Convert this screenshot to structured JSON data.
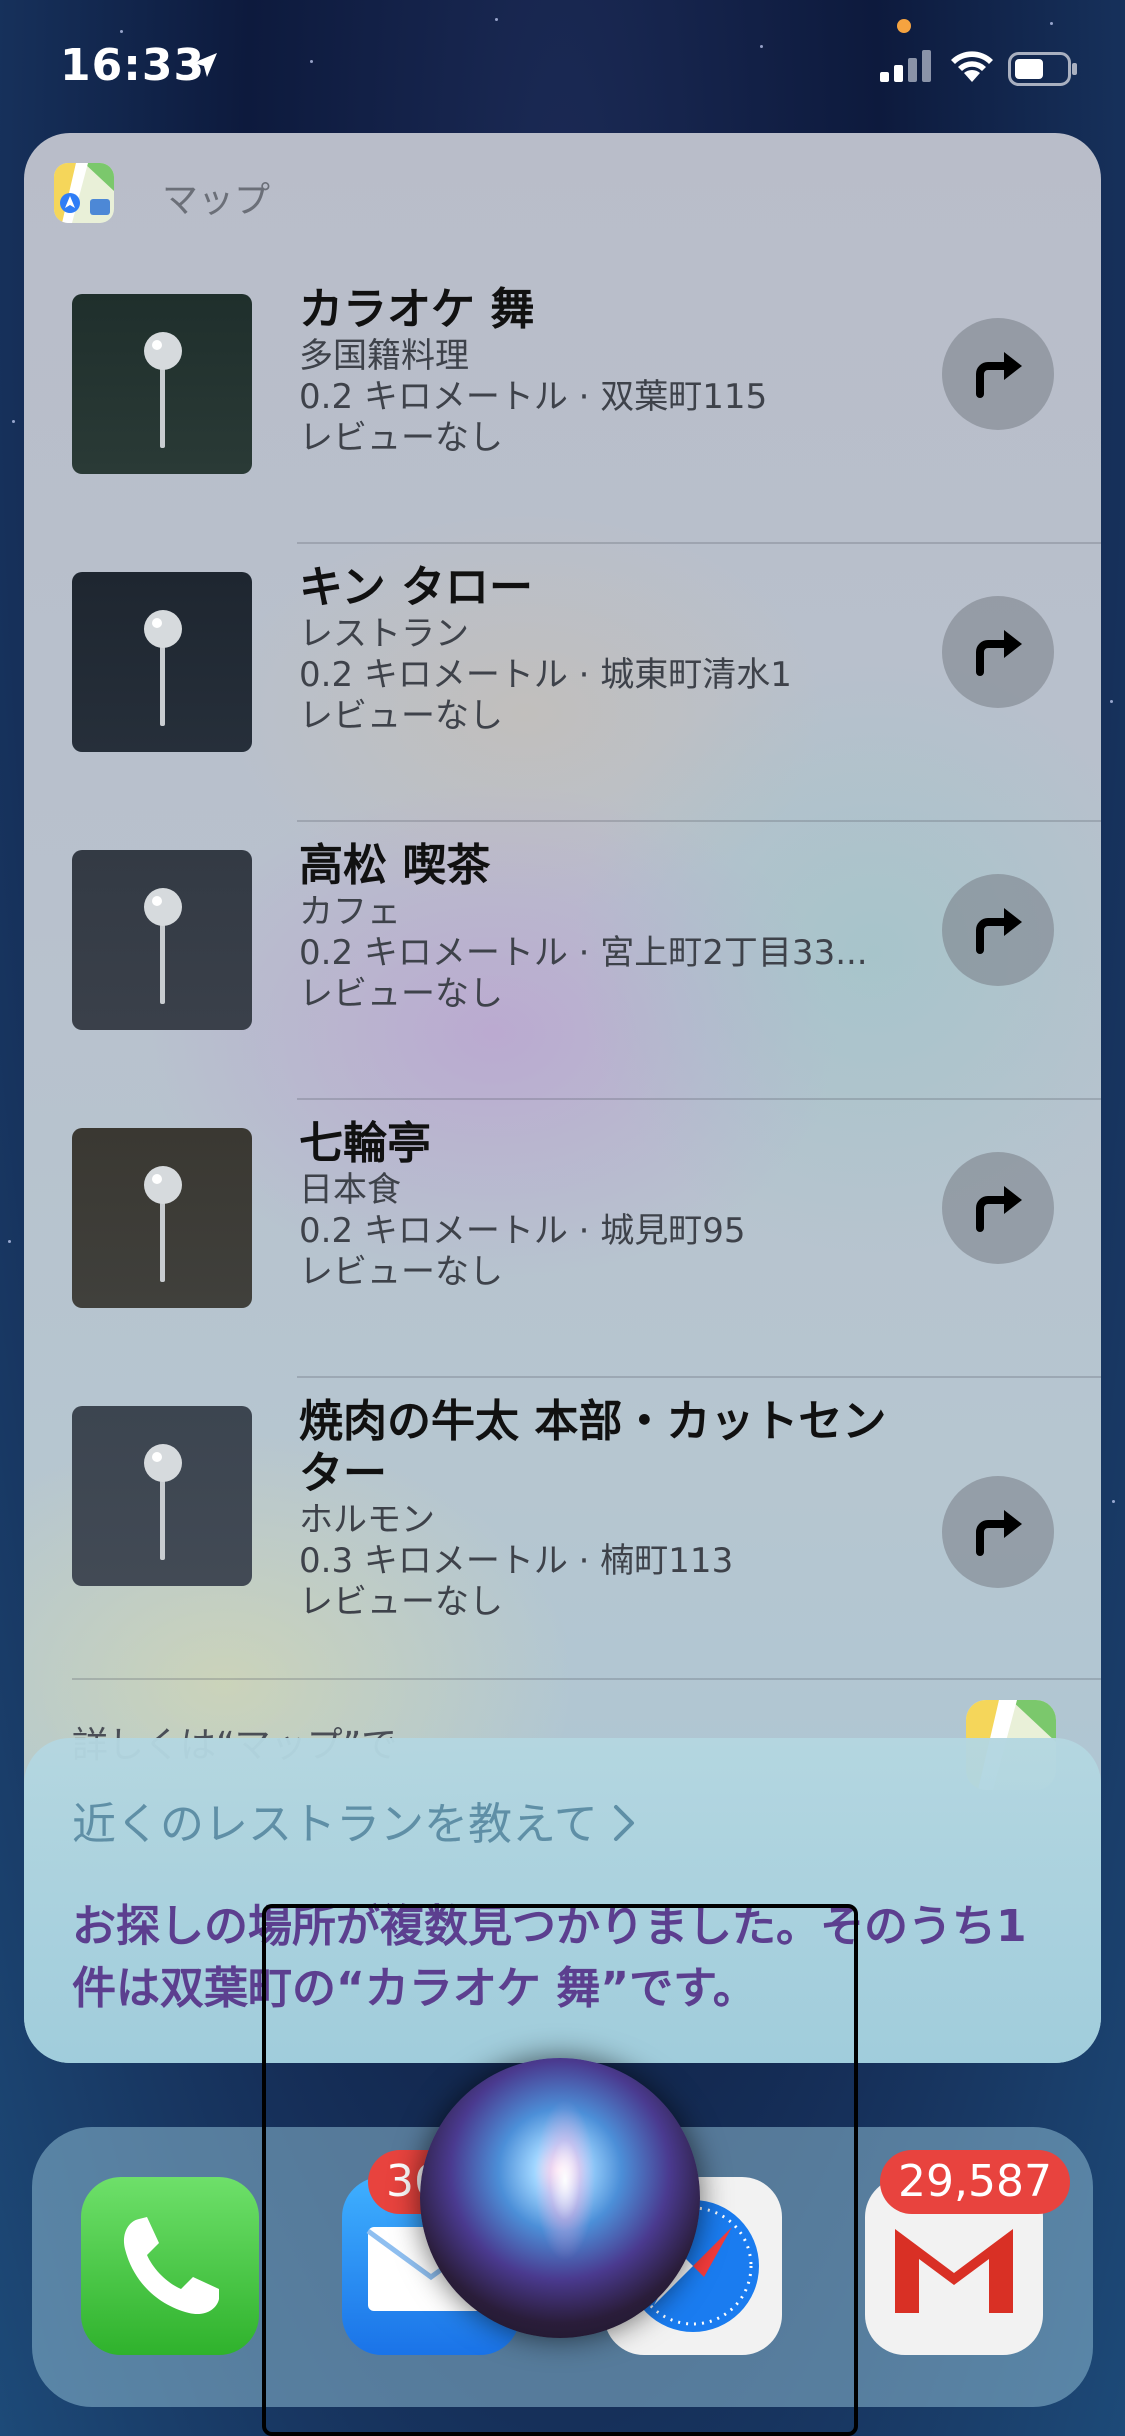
{
  "status_bar": {
    "time": "16:33",
    "location_icon": "location-arrow-icon",
    "signal_icon": "cellular-signal-icon",
    "wifi_icon": "wifi-icon",
    "battery_icon": "battery-icon"
  },
  "maps_card": {
    "app_name": "マップ",
    "app_icon": "maps-app-icon",
    "results": [
      {
        "name": "カラオケ 舞",
        "category": "多国籍料理",
        "distance_address": "0.2 キロメートル · 双葉町115",
        "review": "レビューなし"
      },
      {
        "name": "キン タロー",
        "category": "レストラン",
        "distance_address": "0.2 キロメートル · 城東町清水1",
        "review": "レビューなし"
      },
      {
        "name": "高松 喫茶",
        "category": "カフェ",
        "distance_address": "0.2 キロメートル · 宮上町2丁目33...",
        "review": "レビューなし"
      },
      {
        "name": "七輪亭",
        "category": "日本食",
        "distance_address": "0.2 キロメートル · 城見町95",
        "review": "レビューなし"
      },
      {
        "name": "焼肉の牛太 本部・カットセンター",
        "category": "ホルモン",
        "distance_address": "0.3 キロメートル · 楠町113",
        "review": "レビューなし"
      }
    ],
    "more_text": "詳しくは“マップ”で"
  },
  "siri": {
    "query": "近くのレストランを教えて ",
    "response": "お探しの場所が複数見つかりました。そのうち1件は双葉町の“カラオケ 舞”です。"
  },
  "dock": {
    "mail_badge": "36",
    "gmail_badge": "29,587"
  },
  "colors": {
    "siri_response": "#5c3f8f",
    "siri_query": "#5f8fa6",
    "badge": "#e8433e"
  }
}
